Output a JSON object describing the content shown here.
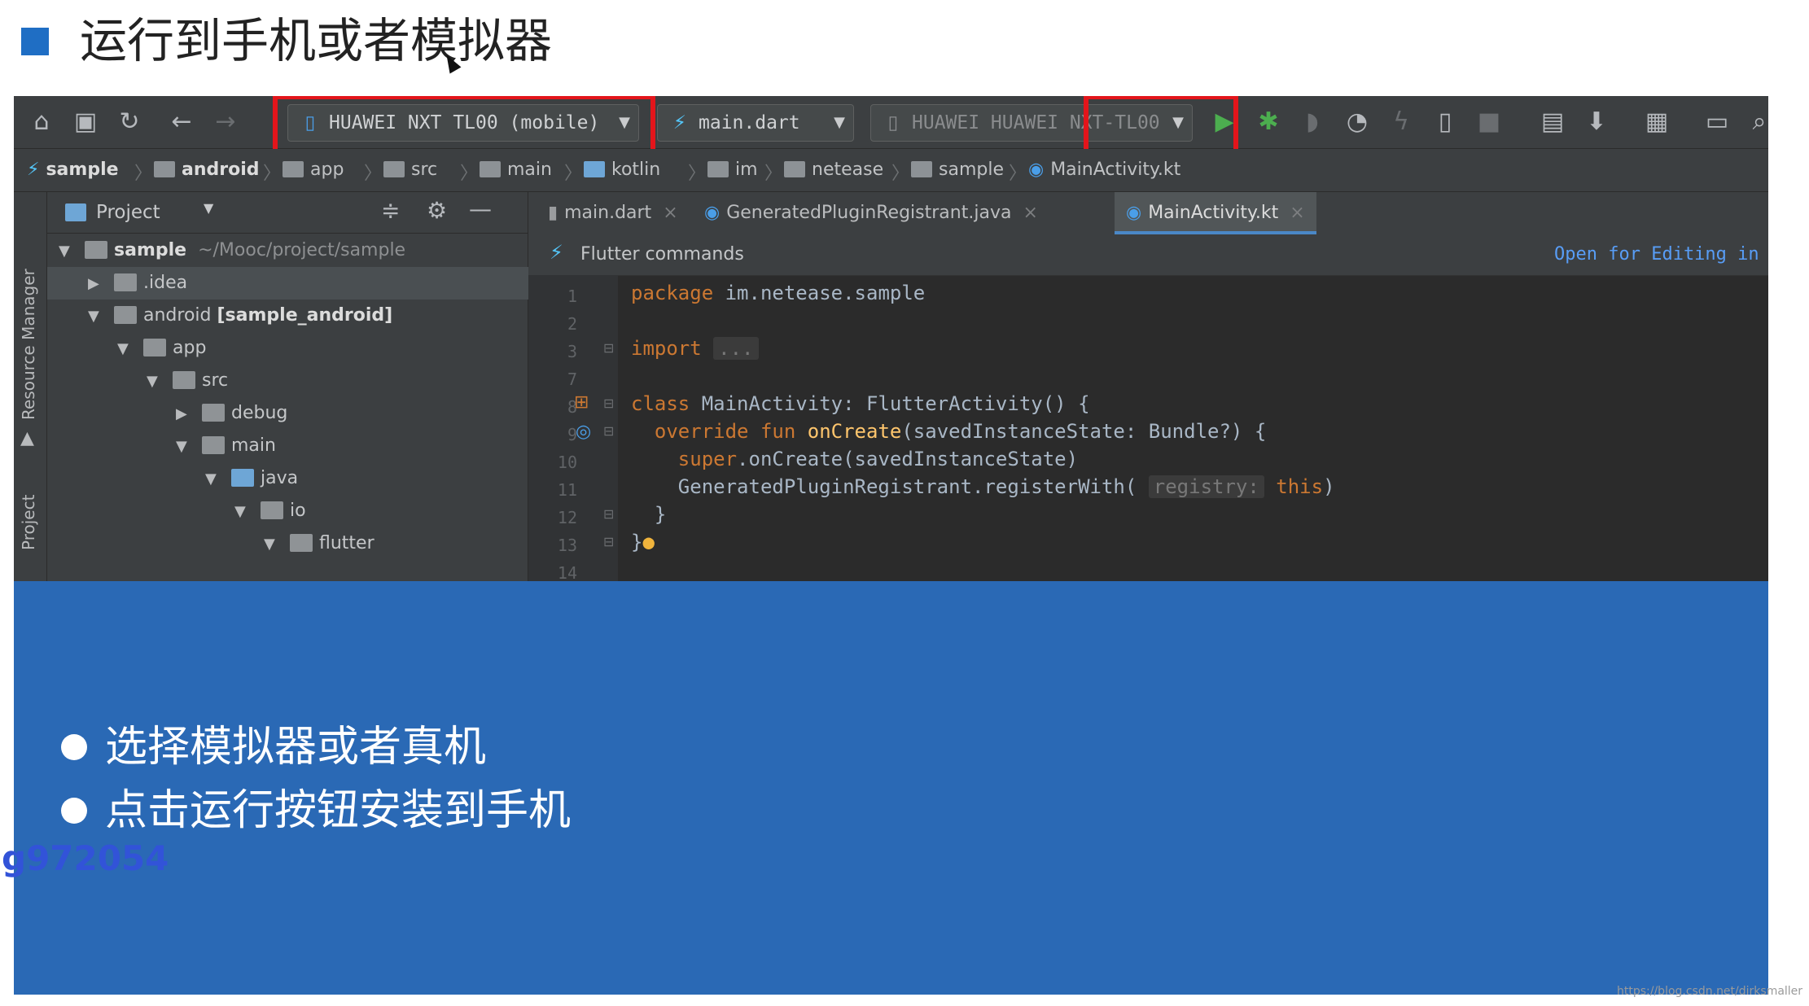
{
  "slide": {
    "title": "运行到手机或者模拟器",
    "bullets": [
      "选择模拟器或者真机",
      "点击运行按钮安装到手机"
    ],
    "watermark": "g972054",
    "footer_url": "https://blog.csdn.net/dirksmaller"
  },
  "toolbar": {
    "device_selector": "HUAWEI NXT TL00 (mobile)",
    "run_config": "main.dart",
    "running_device": "HUAWEI HUAWEI NXT-TL00"
  },
  "breadcrumbs": [
    "sample",
    "android",
    "app",
    "src",
    "main",
    "kotlin",
    "im",
    "netease",
    "sample",
    "MainActivity.kt"
  ],
  "project": {
    "title": "Project",
    "tree": [
      {
        "label": "sample",
        "extra": "~/Mooc/project/sample"
      },
      {
        "label": ".idea",
        "extra": ""
      },
      {
        "label": "android",
        "extra": "[sample_android]"
      },
      {
        "label": "app",
        "extra": ""
      },
      {
        "label": "src",
        "extra": ""
      },
      {
        "label": "debug",
        "extra": ""
      },
      {
        "label": "main",
        "extra": ""
      },
      {
        "label": "java",
        "extra": ""
      },
      {
        "label": "io",
        "extra": ""
      },
      {
        "label": "flutter",
        "extra": ""
      }
    ]
  },
  "side_labels": [
    "Resource Manager",
    "Project"
  ],
  "editor": {
    "tabs": [
      "main.dart",
      "GeneratedPluginRegistrant.java",
      "MainActivity.kt"
    ],
    "flutter_bar": "Flutter commands",
    "open_link": "Open for Editing in Android Studio",
    "line_numbers": [
      "1",
      "2",
      "3",
      "7",
      "8",
      "9",
      "10",
      "11",
      "12",
      "13",
      "14"
    ],
    "code": {
      "l1_kw": "package",
      "l1_rest": " im.netease.sample",
      "l3_kw": "import",
      "l3_fold": "...",
      "l8_kw": "class",
      "l8_rest": " MainActivity: FlutterActivity() {",
      "l9_kw": "override fun",
      "l9_fn": "onCreate",
      "l9_rest": "(savedInstanceState: Bundle?) {",
      "l10_kw": "super",
      "l10_rest": ".onCreate(savedInstanceState)",
      "l11_pre": "GeneratedPluginRegistrant.registerWith(",
      "l11_hint": "registry:",
      "l11_kw": "this",
      "l11_post": ")",
      "l12": "}",
      "l13": "}"
    }
  }
}
